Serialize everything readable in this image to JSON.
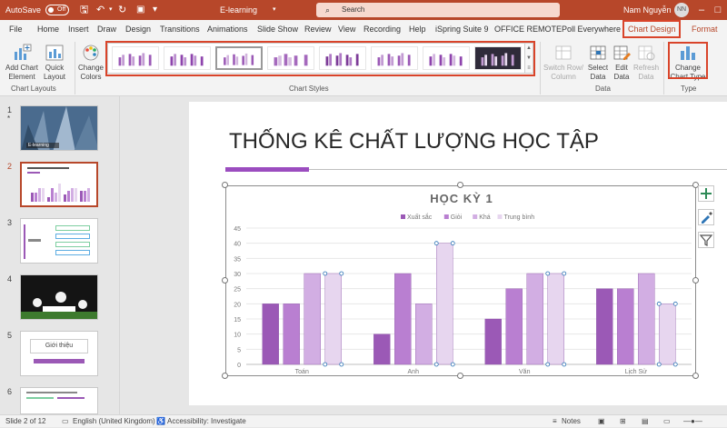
{
  "titlebar": {
    "autosave": "AutoSave",
    "autosave_state": "Off",
    "doc_title": "E-learning",
    "search_placeholder": "Search",
    "user_name": "Nam Nguyễn",
    "user_initials": "NN"
  },
  "tabs": [
    "File",
    "Home",
    "Insert",
    "Draw",
    "Design",
    "Transitions",
    "Animations",
    "Slide Show",
    "Review",
    "View",
    "Recording",
    "Help",
    "iSpring Suite 9",
    "OFFICE REMOTE",
    "Poll Everywhere",
    "Chart Design",
    "Format"
  ],
  "ribbon": {
    "add_chart_element": "Add Chart Element",
    "quick_layout": "Quick Layout",
    "group_chart_layouts": "Chart Layouts",
    "change_colors": "Change Colors",
    "group_chart_styles": "Chart Styles",
    "switch_row_column": "Switch Row/ Column",
    "select_data": "Select Data",
    "edit_data": "Edit Data",
    "refresh_data": "Refresh Data",
    "group_data": "Data",
    "change_chart_type": "Change Chart Type",
    "group_type": "Type"
  },
  "slides": {
    "numbers": [
      "1",
      "2",
      "3",
      "4",
      "5",
      "6"
    ],
    "thumb1_label": "E-learning",
    "thumb5_label": "Giới thiệu"
  },
  "slide": {
    "title": "THỐNG KÊ CHẤT LƯỢNG HỌC TẬP"
  },
  "status": {
    "slide_of": "Slide 2 of 12",
    "language": "English (United Kingdom)",
    "accessibility": "Accessibility: Investigate",
    "notes": "Notes"
  },
  "colors": {
    "accent": "#b7472a",
    "highlight": "#d9442a",
    "series": [
      "#9b59b6",
      "#b97fd1",
      "#d2aee3",
      "#e7d6ef"
    ]
  },
  "chart_data": {
    "type": "bar",
    "title": "HỌC KỲ 1",
    "categories": [
      "Toán",
      "Anh",
      "Văn",
      "Lịch Sử"
    ],
    "series": [
      {
        "name": "Xuất sắc",
        "values": [
          20,
          10,
          15,
          25
        ]
      },
      {
        "name": "Giỏi",
        "values": [
          20,
          30,
          25,
          25
        ]
      },
      {
        "name": "Khá",
        "values": [
          30,
          20,
          30,
          30
        ]
      },
      {
        "name": "Trung bình",
        "values": [
          30,
          40,
          30,
          20
        ]
      }
    ],
    "ylim": [
      0,
      45
    ],
    "yticks": [
      "0",
      "5",
      "10",
      "15",
      "20",
      "25",
      "30",
      "35",
      "40",
      "45"
    ],
    "legend": "top",
    "grid": true
  }
}
